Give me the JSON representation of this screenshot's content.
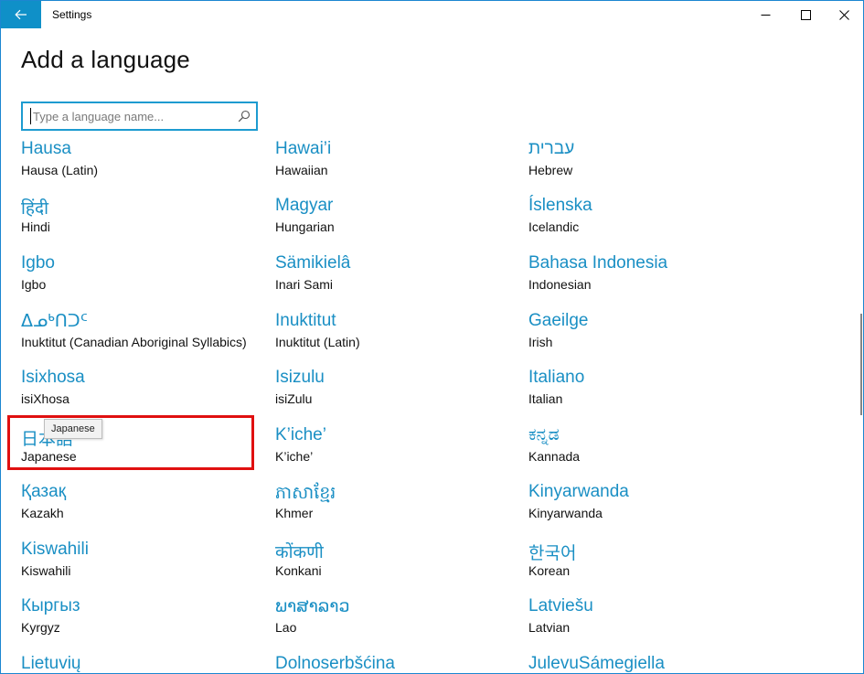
{
  "window": {
    "title": "Settings",
    "accent": "#0f90c8",
    "link_color": "#1a8fc4"
  },
  "page": {
    "title": "Add a language"
  },
  "search": {
    "placeholder": "Type a language name...",
    "value": ""
  },
  "tooltip": {
    "text": "Japanese"
  },
  "languages": [
    {
      "native": "Hausa",
      "english": "Hausa (Latin)"
    },
    {
      "native": "Hawai’i",
      "english": "Hawaiian"
    },
    {
      "native": "עברית",
      "english": "Hebrew"
    },
    {
      "native": "हिंदी",
      "english": "Hindi"
    },
    {
      "native": "Magyar",
      "english": "Hungarian"
    },
    {
      "native": "Íslenska",
      "english": "Icelandic"
    },
    {
      "native": "Igbo",
      "english": "Igbo"
    },
    {
      "native": "Sämikielâ",
      "english": "Inari Sami"
    },
    {
      "native": "Bahasa Indonesia",
      "english": "Indonesian"
    },
    {
      "native": "ᐃᓄᒃᑎᑐᑦ",
      "english": "Inuktitut (Canadian Aboriginal Syllabics)"
    },
    {
      "native": "Inuktitut",
      "english": "Inuktitut (Latin)"
    },
    {
      "native": "Gaeilge",
      "english": "Irish"
    },
    {
      "native": "Isixhosa",
      "english": "isiXhosa"
    },
    {
      "native": "Isizulu",
      "english": "isiZulu"
    },
    {
      "native": "Italiano",
      "english": "Italian"
    },
    {
      "native": "日本語",
      "english": "Japanese"
    },
    {
      "native": "K’iche’",
      "english": "K’iche’"
    },
    {
      "native": "ಕನ್ನಡ",
      "english": "Kannada"
    },
    {
      "native": "Қазақ",
      "english": "Kazakh"
    },
    {
      "native": "ភាសាខ្មែរ",
      "english": "Khmer"
    },
    {
      "native": "Kinyarwanda",
      "english": "Kinyarwanda"
    },
    {
      "native": "Kiswahili",
      "english": "Kiswahili"
    },
    {
      "native": "कोंकणी",
      "english": "Konkani"
    },
    {
      "native": "한국어",
      "english": "Korean"
    },
    {
      "native": "Кыргыз",
      "english": "Kyrgyz"
    },
    {
      "native": "ພາສາລາວ",
      "english": "Lao"
    },
    {
      "native": "Latviešu",
      "english": "Latvian"
    },
    {
      "native": "Lietuvių",
      "english": ""
    },
    {
      "native": "Dolnoserbšćina",
      "english": ""
    },
    {
      "native": "JulevuSámegiella",
      "english": ""
    }
  ]
}
